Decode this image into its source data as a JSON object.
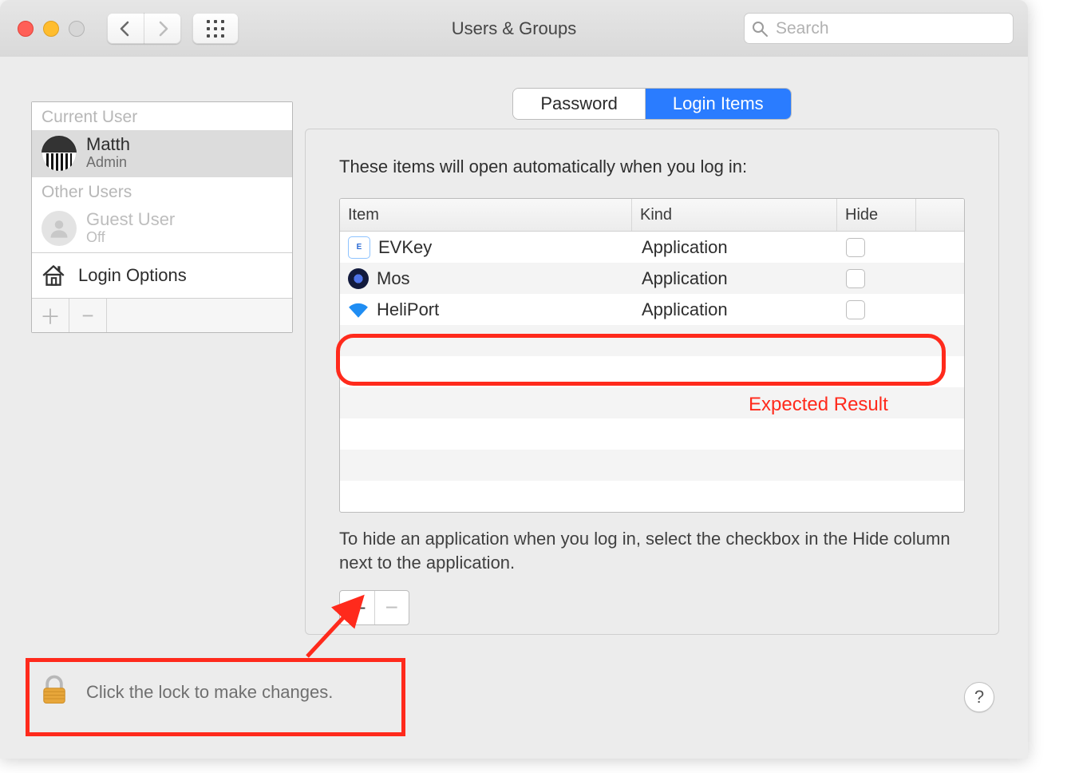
{
  "window": {
    "title": "Users & Groups"
  },
  "search": {
    "placeholder": "Search"
  },
  "sidebar": {
    "section_current": "Current User",
    "section_other": "Other Users",
    "current_user": {
      "name": "Matth",
      "role": "Admin"
    },
    "guest": {
      "name": "Guest User",
      "status": "Off"
    },
    "login_options": "Login Options"
  },
  "tabs": {
    "password": "Password",
    "login_items": "Login Items"
  },
  "hint": "These items will open automatically when you log in:",
  "columns": {
    "item": "Item",
    "kind": "Kind",
    "hide": "Hide"
  },
  "items": [
    {
      "name": "EVKey",
      "kind": "Application",
      "icon": "evkey"
    },
    {
      "name": "Mos",
      "kind": "Application",
      "icon": "mos"
    },
    {
      "name": "HeliPort",
      "kind": "Application",
      "icon": "heliport"
    }
  ],
  "below_hint": "To hide an application when you log in, select the checkbox in the Hide column next to the application.",
  "lock_text": "Click the lock to make changes.",
  "help": "?",
  "annotation": {
    "expected": "Expected Result"
  }
}
